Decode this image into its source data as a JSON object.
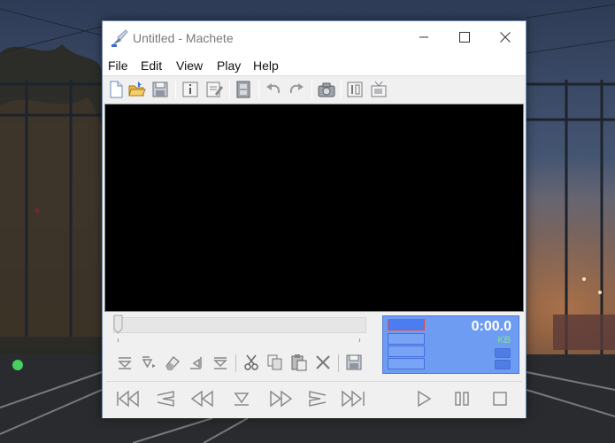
{
  "window": {
    "title": "Untitled - Machete",
    "controls": {
      "minimize": "minimize-icon",
      "maximize": "maximize-icon",
      "close": "close-icon"
    }
  },
  "menubar": {
    "items": [
      {
        "label": "File"
      },
      {
        "label": "Edit"
      },
      {
        "label": "View"
      },
      {
        "label": "Play"
      },
      {
        "label": "Help"
      }
    ]
  },
  "toolbar": {
    "buttons": [
      "new-file-icon",
      "open-folder-icon",
      "save-icon",
      "info-icon",
      "edit-tags-icon",
      "film-icon",
      "undo-icon",
      "redo-icon",
      "snapshot-camera-icon",
      "frame-icon",
      "tv-icon"
    ]
  },
  "edit_tools": {
    "buttons": [
      "mark-in-icon",
      "mark-play-icon",
      "eraser-icon",
      "mark-back-icon",
      "mark-out-icon",
      "cut-icon",
      "copy-icon",
      "paste-icon",
      "delete-icon",
      "save-selection-icon"
    ]
  },
  "transport": {
    "buttons": [
      "skip-to-start-icon",
      "prev-marker-icon",
      "rewind-icon",
      "goto-mark-icon",
      "fast-forward-icon",
      "next-marker-icon",
      "skip-to-end-icon",
      "play-icon",
      "pause-icon",
      "stop-icon"
    ]
  },
  "display": {
    "time": "0:00.0",
    "size_unit": "KB"
  },
  "colors": {
    "display_bg": "#6f9cf3",
    "kb_text": "#7de88b",
    "video_bg": "#000000"
  }
}
